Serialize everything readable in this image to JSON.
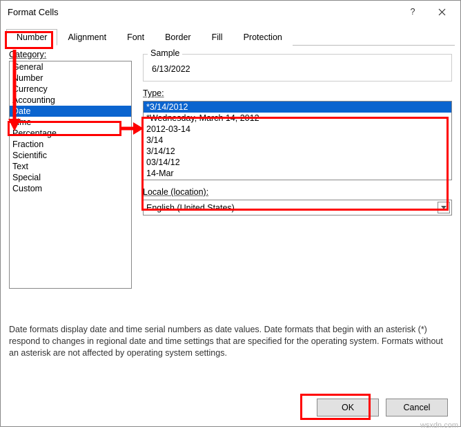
{
  "titlebar": {
    "title": "Format Cells"
  },
  "tabs": [
    {
      "label": "Number",
      "active": true
    },
    {
      "label": "Alignment",
      "active": false
    },
    {
      "label": "Font",
      "active": false
    },
    {
      "label": "Border",
      "active": false
    },
    {
      "label": "Fill",
      "active": false
    },
    {
      "label": "Protection",
      "active": false
    }
  ],
  "category": {
    "label": "Category:",
    "items": [
      "General",
      "Number",
      "Currency",
      "Accounting",
      "Date",
      "Time",
      "Percentage",
      "Fraction",
      "Scientific",
      "Text",
      "Special",
      "Custom"
    ],
    "selected_index": 4
  },
  "sample": {
    "label": "Sample",
    "value": "6/13/2022"
  },
  "type": {
    "label": "Type:",
    "items": [
      "*3/14/2012",
      "*Wednesday, March 14, 2012",
      "2012-03-14",
      "3/14",
      "3/14/12",
      "03/14/12",
      "14-Mar"
    ],
    "selected_index": 0
  },
  "locale": {
    "label": "Locale (location):",
    "value": "English (United States)"
  },
  "help_text": "Date formats display date and time serial numbers as date values.  Date formats that begin with an asterisk (*) respond to changes in regional date and time settings that are specified for the operating system. Formats without an asterisk are not affected by operating system settings.",
  "buttons": {
    "ok": "OK",
    "cancel": "Cancel"
  },
  "watermark": "wsxdn.com"
}
